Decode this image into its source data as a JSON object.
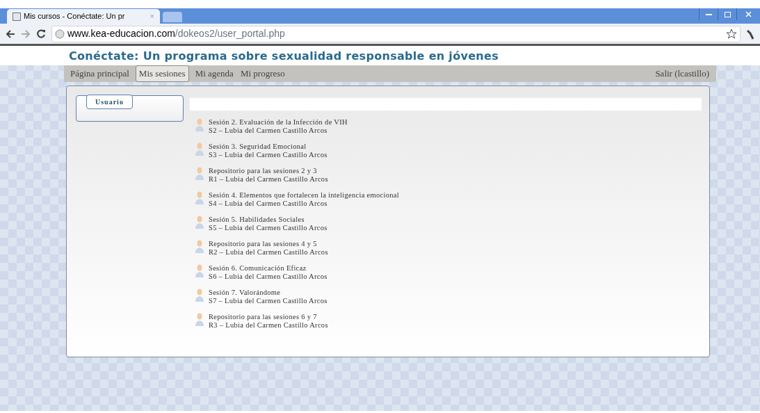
{
  "browser": {
    "tab_title": "Mis cursos - Conéctate: Un pr",
    "tab_close": "×",
    "url_host": "www.kea-educacion.com",
    "url_path": "/dokeos2/user_portal.php"
  },
  "site_title": "Conéctate: Un programa sobre sexualidad responsable en jóvenes",
  "nav": [
    {
      "label": "Página principal",
      "selected": false
    },
    {
      "label": "Mis sesiones",
      "selected": true
    },
    {
      "label": "Mi agenda",
      "selected": false
    },
    {
      "label": "Mi progreso",
      "selected": false
    }
  ],
  "logout": "Salir (lcastillo)",
  "user_box": {
    "title": "Usuario"
  },
  "courses": [
    {
      "title": "Sesión 2. Evaluación de la Infección de VIH",
      "subtitle": "S2 – Lubia del Carmen Castillo Arcos"
    },
    {
      "title": "Sesión 3. Seguridad Emocional",
      "subtitle": "S3 – Lubia del Carmen Castillo Arcos"
    },
    {
      "title": "Repositorio para las sesiones 2 y 3",
      "subtitle": "R1 – Lubia del Carmen Castillo Arcos"
    },
    {
      "title": "Sesión 4. Elementos que fortalecen la inteligencia emocional",
      "subtitle": "S4 – Lubia del Carmen Castillo Arcos"
    },
    {
      "title": "Sesión 5. Habilidades Sociales",
      "subtitle": "S5 – Lubia del Carmen Castillo Arcos"
    },
    {
      "title": "Repositorio para las sesiones 4 y 5",
      "subtitle": "R2 – Lubia del Carmen Castillo Arcos"
    },
    {
      "title": "Sesión 6. Comunicación Eficaz",
      "subtitle": "S6 – Lubia del Carmen Castillo Arcos"
    },
    {
      "title": "Sesión 7. Valorándome",
      "subtitle": "S7 – Lubia del Carmen Castillo Arcos"
    },
    {
      "title": "Repositorio para las sesiones 6 y 7",
      "subtitle": "R3 – Lubia del Carmen Castillo Arcos"
    }
  ]
}
